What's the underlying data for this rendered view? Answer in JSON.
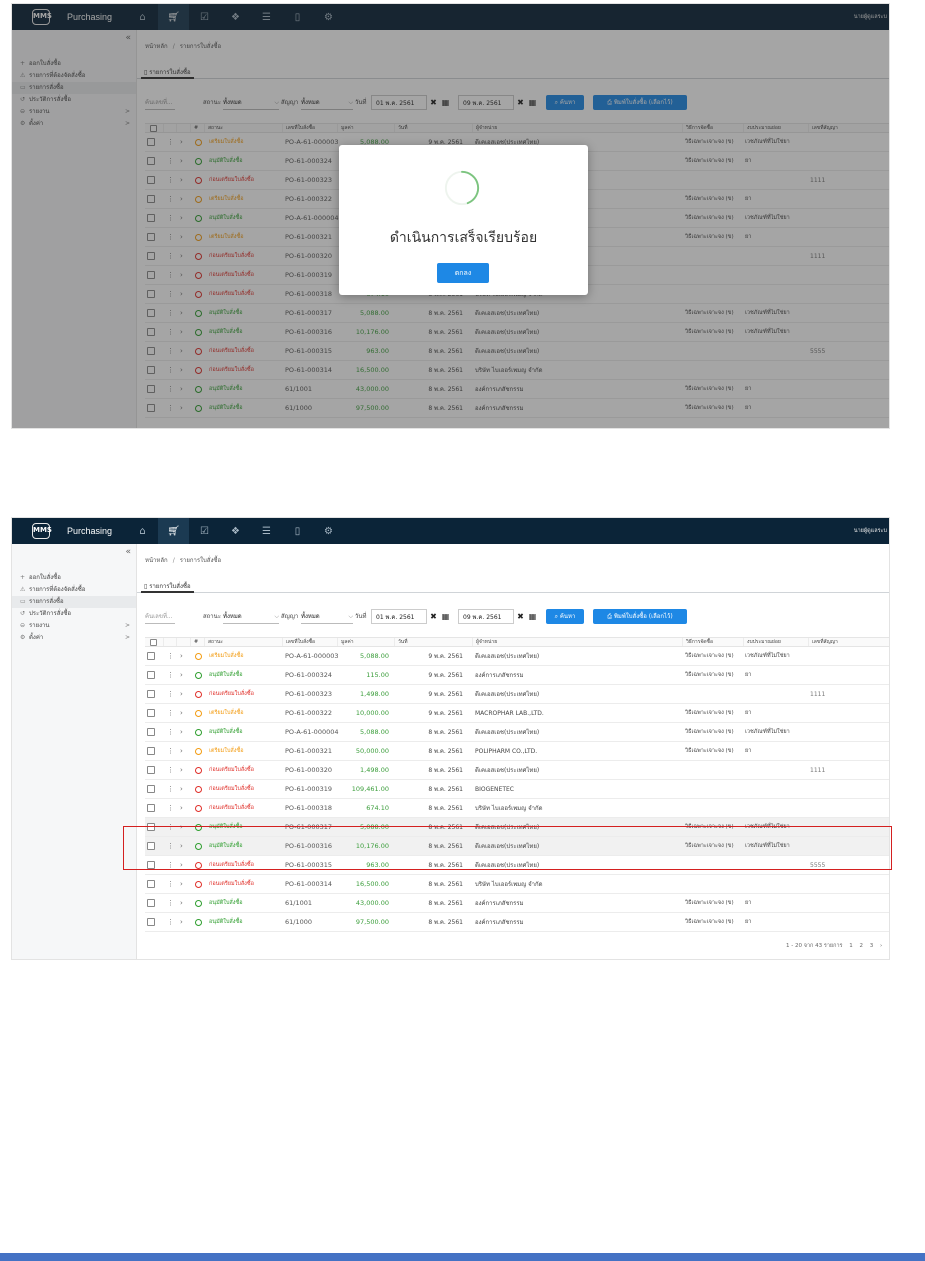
{
  "app": {
    "name": "Purchasing",
    "user": "นายผู้ดูแลระบ",
    "logo": "MMS"
  },
  "topnav": [
    "home-icon",
    "cart-icon",
    "check-square-icon",
    "box-icon",
    "database-icon",
    "document-icon",
    "settings-icon"
  ],
  "sidebar": {
    "collapse": "«",
    "items": [
      {
        "icon": "+",
        "label": "ออกใบสั่งซื้อ",
        "arrow": ""
      },
      {
        "icon": "⚠",
        "label": "รายการที่ต้องจัดสั่งซื้อ",
        "arrow": ""
      },
      {
        "icon": "▭",
        "label": "รายการสั่งซื้อ",
        "arrow": ""
      },
      {
        "icon": "↺",
        "label": "ประวัติการสั่งซื้อ",
        "arrow": ""
      },
      {
        "icon": "⊖",
        "label": "รายงาน",
        "arrow": ">"
      },
      {
        "icon": "⚙",
        "label": "ตั้งค่า",
        "arrow": ">"
      }
    ]
  },
  "breadcrumb": {
    "home": "หน้าหลัก",
    "sep": "/",
    "current": "รายการใบสั่งซื้อ"
  },
  "tab": {
    "label": "รายการใบสั่งซื้อ"
  },
  "filters": {
    "search_placeholder": "ค้นเลขที่...",
    "status_label": "สถานะ",
    "status_value": "ทั้งหมด",
    "contract_label": "สัญญา",
    "contract_value": "ทั้งหมด",
    "date_label": "วันที่",
    "date_from": "01 พ.ค. 2561",
    "date_to": "09 พ.ค. 2561",
    "clear": "✖",
    "calendar": "▦",
    "search_button": "ค้นหา",
    "print_button": "พิมพ์ใบสั่งซื้อ (เลือกไว้)"
  },
  "columns": [
    "#",
    "สถานะ",
    "เลขที่ใบสั่งซื้อ",
    "มูลค่า",
    "วันที่",
    "ผู้จำหน่าย",
    "วิธีการจัดซื้อ",
    "งบประมาณย่อย",
    "เลขที่สัญญา"
  ],
  "rows": [
    {
      "status": "เตรียมใบสั่งซื้อ",
      "status_color": "#f39c12",
      "code": "PO-A-61-000003",
      "price": "5,088.00",
      "date": "9 พ.ค. 2561",
      "vendor": "ดีเคเอสเอช(ประเทศไทย)",
      "method": "วิธีเฉพาะเจาะจง (ข)",
      "budget": "เวชภัณฑ์ที่ไม่ใช่ยา",
      "contract": ""
    },
    {
      "status": "อนุมัติใบสั่งซื้อ",
      "status_color": "#2e9e2e",
      "code": "PO-61-000324",
      "price": "115.00",
      "date": "9 พ.ค. 2561",
      "vendor": "องค์การเภสัชกรรม",
      "method": "วิธีเฉพาะเจาะจง (ข)",
      "budget": "ยา",
      "contract": ""
    },
    {
      "status": "ก่อนเตรียมใบสั่งซื้อ",
      "status_color": "#e0302a",
      "code": "PO-61-000323",
      "price": "1,498.00",
      "date": "9 พ.ค. 2561",
      "vendor": "ดีเคเอสเอช(ประเทศไทย)",
      "method": "",
      "budget": "",
      "contract": "1111"
    },
    {
      "status": "เตรียมใบสั่งซื้อ",
      "status_color": "#f39c12",
      "code": "PO-61-000322",
      "price": "10,000.00",
      "date": "9 พ.ค. 2561",
      "vendor": "MACROPHAR LAB.,LTD.",
      "method": "วิธีเฉพาะเจาะจง (ข)",
      "budget": "ยา",
      "contract": ""
    },
    {
      "status": "อนุมัติใบสั่งซื้อ",
      "status_color": "#2e9e2e",
      "code": "PO-A-61-000004",
      "price": "5,088.00",
      "date": "8 พ.ค. 2561",
      "vendor": "ดีเคเอสเอช(ประเทศไทย)",
      "method": "วิธีเฉพาะเจาะจง (ข)",
      "budget": "เวชภัณฑ์ที่ไม่ใช่ยา",
      "contract": ""
    },
    {
      "status": "เตรียมใบสั่งซื้อ",
      "status_color": "#f39c12",
      "code": "PO-61-000321",
      "price": "50,000.00",
      "date": "8 พ.ค. 2561",
      "vendor": "POLIPHARM CO.,LTD.",
      "method": "วิธีเฉพาะเจาะจง (ข)",
      "budget": "ยา",
      "contract": ""
    },
    {
      "status": "ก่อนเตรียมใบสั่งซื้อ",
      "status_color": "#e0302a",
      "code": "PO-61-000320",
      "price": "1,498.00",
      "date": "8 พ.ค. 2561",
      "vendor": "ดีเคเอสเอช(ประเทศไทย)",
      "method": "",
      "budget": "",
      "contract": "1111"
    },
    {
      "status": "ก่อนเตรียมใบสั่งซื้อ",
      "status_color": "#e0302a",
      "code": "PO-61-000319",
      "price": "109,461.00",
      "date": "8 พ.ค. 2561",
      "vendor": "BIOGENETEC",
      "method": "",
      "budget": "",
      "contract": ""
    },
    {
      "status": "ก่อนเตรียมใบสั่งซื้อ",
      "status_color": "#e0302a",
      "code": "PO-61-000318",
      "price": "674.10",
      "date": "8 พ.ค. 2561",
      "vendor": "บริษัท ไบเออร์เพมญ จำกัด",
      "method": "",
      "budget": "",
      "contract": ""
    },
    {
      "status": "อนุมัติใบสั่งซื้อ",
      "status_color": "#2e9e2e",
      "code": "PO-61-000317",
      "price": "5,088.00",
      "date": "8 พ.ค. 2561",
      "vendor": "ดีเคเอสเอช(ประเทศไทย)",
      "method": "วิธีเฉพาะเจาะจง (ข)",
      "budget": "เวชภัณฑ์ที่ไม่ใช่ยา",
      "contract": ""
    },
    {
      "status": "อนุมัติใบสั่งซื้อ",
      "status_color": "#2e9e2e",
      "code": "PO-61-000316",
      "price": "10,176.00",
      "date": "8 พ.ค. 2561",
      "vendor": "ดีเคเอสเอช(ประเทศไทย)",
      "method": "วิธีเฉพาะเจาะจง (ข)",
      "budget": "เวชภัณฑ์ที่ไม่ใช่ยา",
      "contract": ""
    },
    {
      "status": "ก่อนเตรียมใบสั่งซื้อ",
      "status_color": "#e0302a",
      "code": "PO-61-000315",
      "price": "963.00",
      "date": "8 พ.ค. 2561",
      "vendor": "ดีเคเอสเอช(ประเทศไทย)",
      "method": "",
      "budget": "",
      "contract": "5555"
    },
    {
      "status": "ก่อนเตรียมใบสั่งซื้อ",
      "status_color": "#e0302a",
      "code": "PO-61-000314",
      "price": "16,500.00",
      "date": "8 พ.ค. 2561",
      "vendor": "บริษัท ไบเออร์เพมญ จำกัด",
      "method": "",
      "budget": "",
      "contract": ""
    },
    {
      "status": "อนุมัติใบสั่งซื้อ",
      "status_color": "#2e9e2e",
      "code": "61/1001",
      "price": "43,000.00",
      "date": "8 พ.ค. 2561",
      "vendor": "องค์การเภสัชกรรม",
      "method": "วิธีเฉพาะเจาะจง (ข)",
      "budget": "ยา",
      "contract": ""
    },
    {
      "status": "อนุมัติใบสั่งซื้อ",
      "status_color": "#2e9e2e",
      "code": "61/1000",
      "price": "97,500.00",
      "date": "8 พ.ค. 2561",
      "vendor": "องค์การเภสัชกรรม",
      "method": "วิธีเฉพาะเจาะจง (ข)",
      "budget": "ยา",
      "contract": ""
    }
  ],
  "selected_rows": [
    9,
    10
  ],
  "pagination": {
    "info": "1 - 20 จาก 43 รายการ",
    "pages": [
      "1",
      "2",
      "3",
      "›"
    ]
  },
  "modal": {
    "title": "ดำเนินการเสร็จเรียบร้อย",
    "ok": "ตกลง",
    "accent": "#7cc47f"
  },
  "colors": {
    "appbar": "#0b2438",
    "primary": "#1e88e5",
    "highlight": "#d42020",
    "footer": "#4472c4"
  }
}
